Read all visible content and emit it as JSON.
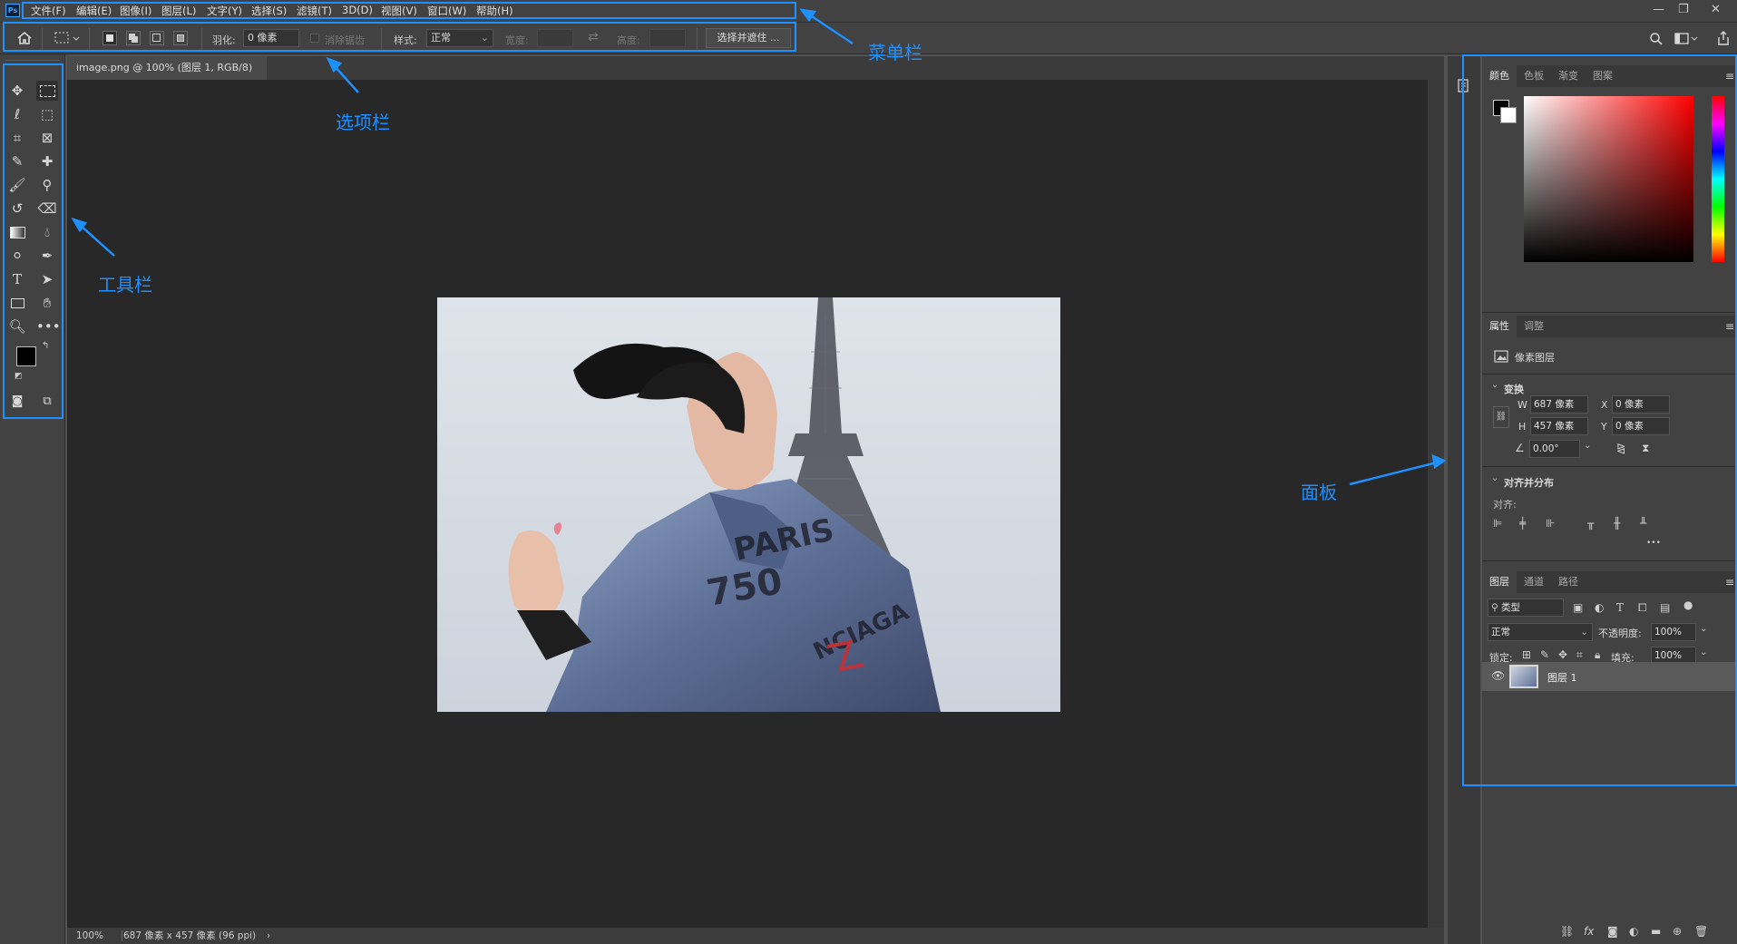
{
  "app": {
    "logo": "Ps"
  },
  "menu": {
    "items": [
      "文件(F)",
      "编辑(E)",
      "图像(I)",
      "图层(L)",
      "文字(Y)",
      "选择(S)",
      "滤镜(T)",
      "3D(D)",
      "视图(V)",
      "窗口(W)",
      "帮助(H)"
    ]
  },
  "window_controls": {
    "minimize": "—",
    "restore": "❐",
    "close": "✕"
  },
  "options": {
    "feather_label": "羽化:",
    "feather_value": "0 像素",
    "antialias_label": "消除锯齿",
    "style_label": "样式:",
    "style_value": "正常",
    "width_label": "宽度:",
    "height_label": "高度:",
    "select_mask_button": "选择并遮住 ..."
  },
  "document": {
    "tab_title": "image.png @ 100% (图层 1, RGB/8)",
    "close_glyph": "×",
    "zoom": "100%",
    "info": "687 像素 x 457 像素 (96 ppi)",
    "status_arrow": "›"
  },
  "panels": {
    "color_tabs": [
      "颜色",
      "色板",
      "渐变",
      "图案"
    ],
    "properties_tabs": [
      "属性",
      "调整"
    ],
    "pixel_layer_label": "像素图层",
    "transform_header": "变换",
    "transform": {
      "w_label": "W",
      "w_value": "687 像素",
      "x_label": "X",
      "x_value": "0 像素",
      "h_label": "H",
      "h_value": "457 像素",
      "y_label": "Y",
      "y_value": "0 像素",
      "angle_value": "0.00°"
    },
    "align_header": "对齐并分布",
    "align_label": "对齐:",
    "more_glyph": "•••",
    "layers_tabs": [
      "图层",
      "通道",
      "路径"
    ],
    "layers": {
      "filter_kind": "类型",
      "blend_mode": "正常",
      "opacity_label": "不透明度:",
      "opacity_value": "100%",
      "lock_label": "锁定:",
      "fill_label": "填充:",
      "fill_value": "100%",
      "items": [
        {
          "name": "图层 1"
        }
      ]
    }
  },
  "annotations": {
    "menubar": "菜单栏",
    "optionsbar": "选项栏",
    "toolbar": "工具栏",
    "panels": "面板"
  },
  "colors": {
    "annotation": "#1e90ff",
    "ui_dark": "#424242",
    "canvas": "#282828",
    "foreground": "#000000",
    "background": "#ffffff"
  }
}
